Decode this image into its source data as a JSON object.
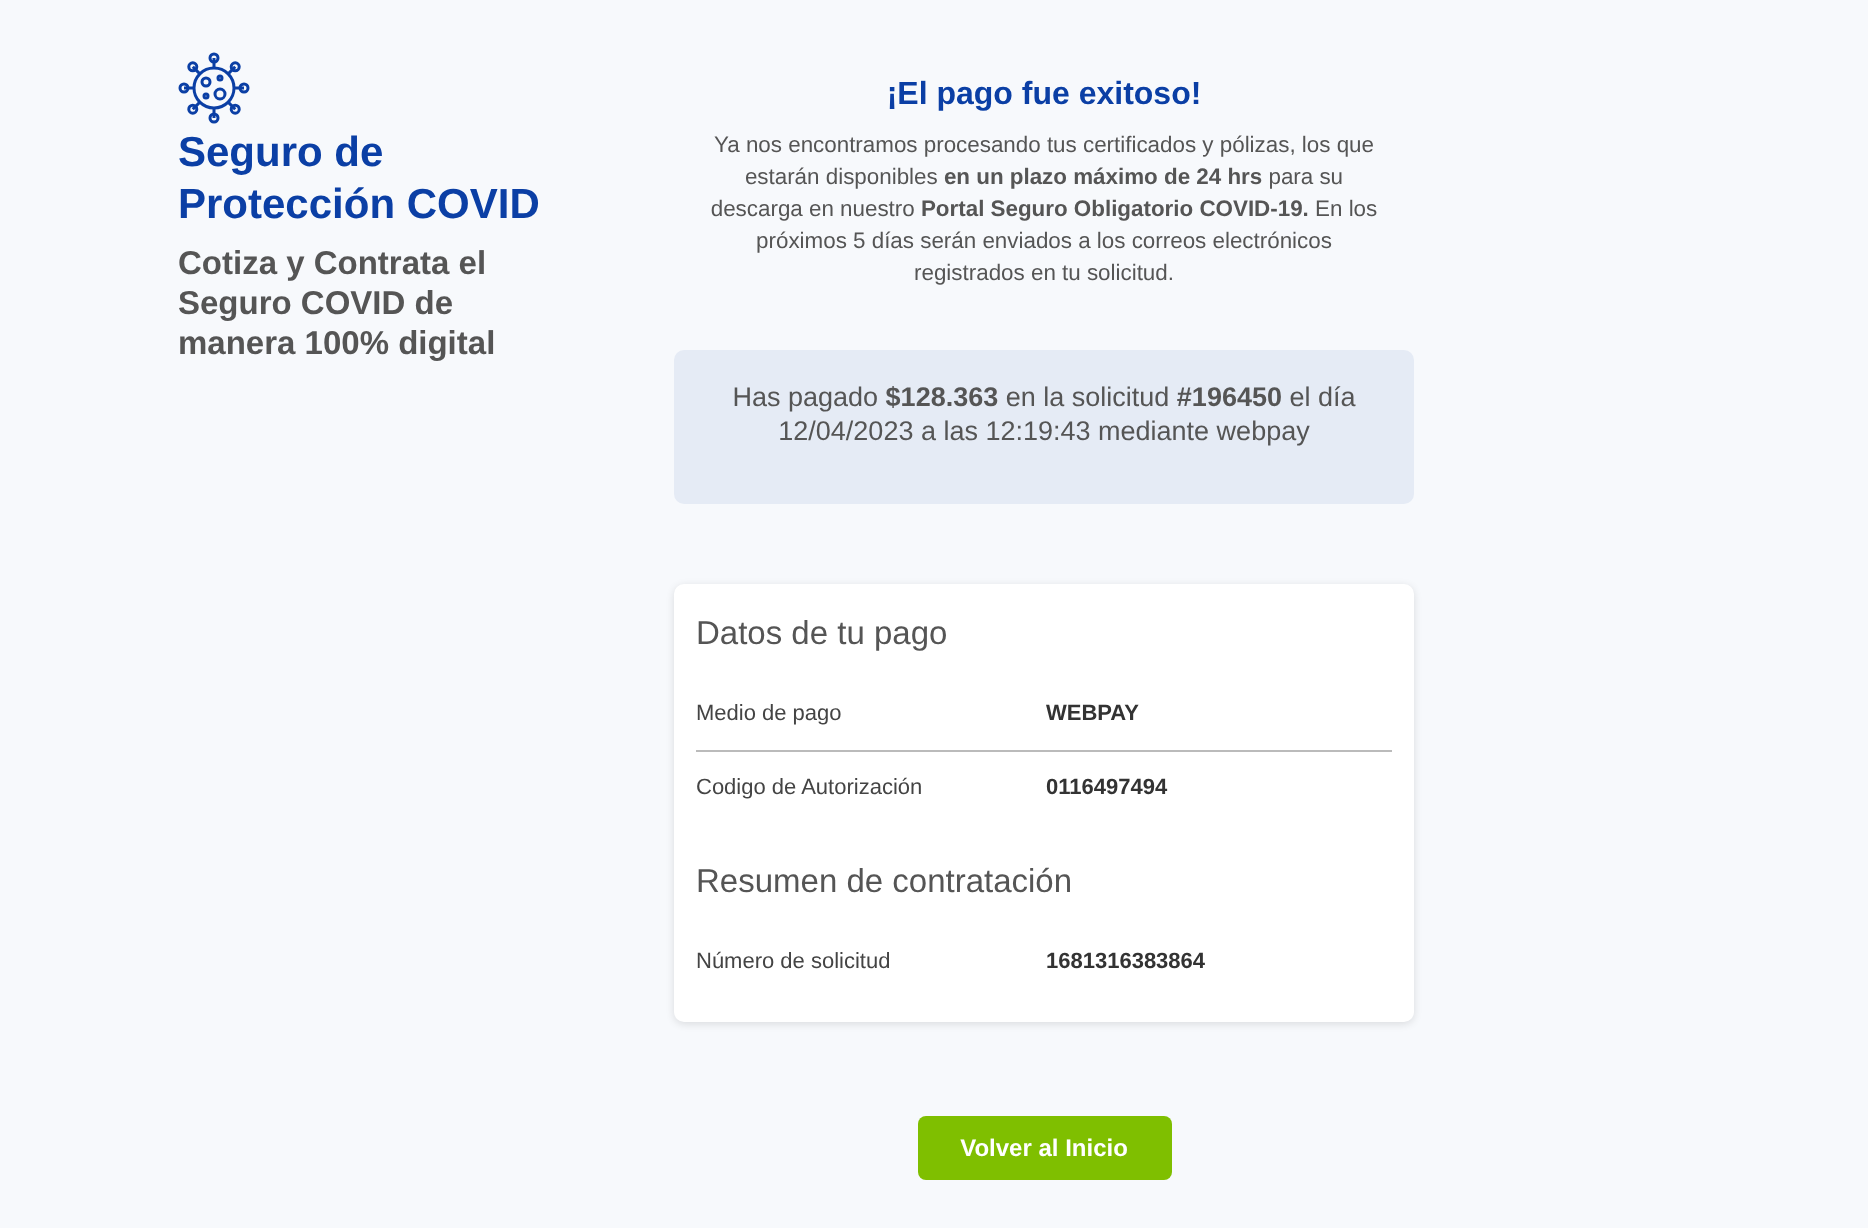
{
  "brand": {
    "title": "Seguro de Protección COVID",
    "subtitle": "Cotiza y Contrata el Seguro COVID de manera 100% digital"
  },
  "success": {
    "title": "¡El pago fue exitoso!",
    "message": "Ya nos encontramos procesando tus certificados y pólizas, los que estarán disponibles **en un plazo máximo de 24 hrs** para su descarga en nuestro **Portal Seguro Obligatorio COVID-19.** En los próximos 5 días serán enviados a los correos electrónicos registrados en tu solicitud."
  },
  "payment_notice": "Has pagado **$128.363** en la solicitud **#196450** el día 12/04/2023 a las 12:19:43 mediante webpay",
  "sections": [
    {
      "title": "Datos de tu pago",
      "rows": [
        {
          "label": "Medio de pago",
          "value": "WEBPAY",
          "divider": true
        },
        {
          "label": "Codigo de Autorización",
          "value": "0116497494",
          "divider": false
        }
      ]
    },
    {
      "title": "Resumen de contratación",
      "rows": [
        {
          "label": "Número de solicitud",
          "value": "1681316383864",
          "divider": false
        }
      ]
    }
  ],
  "button": "Volver al Inicio"
}
